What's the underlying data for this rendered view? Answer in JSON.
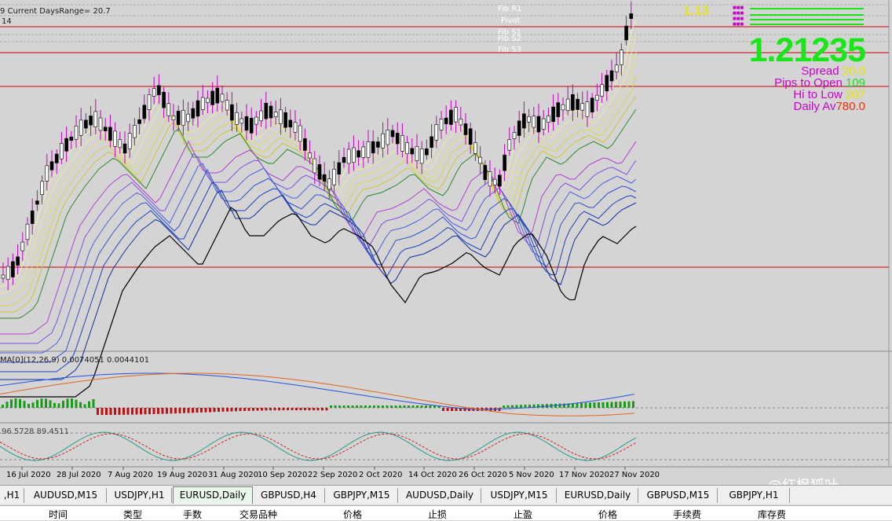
{
  "chart_info": {
    "line1": "9 Current DaysRange= 20.7",
    "line2": "14",
    "macd_label": "MA[0](12,26,9) 0.0074051 0.0044101",
    "stoch_label": "96.5728 89.4511"
  },
  "levels": {
    "fib_r1": "Fib R1",
    "pivot": "Pivot",
    "fib_s1": "Fib S1",
    "fib_s2": "Fib S2",
    "fib_s3": "Fib S3",
    "top_marker": "1.13"
  },
  "price_panel": {
    "price": "1.21235",
    "spread_label": "Spread",
    "spread_value": "20.0",
    "pips_open_label": "Pips to Open",
    "pips_open_value": "109",
    "hi_low_label": "Hi to Low",
    "hi_low_value": "207",
    "daily_av_label": "Daily Av",
    "daily_av_value": "780.0"
  },
  "date_axis": [
    "16 Jul 2020",
    "28 Jul 2020",
    "7 Aug 2020",
    "19 Aug 2020",
    "31 Aug 2020",
    "10 Sep 2020",
    "22 Sep 2020",
    "2 Oct 2020",
    "14 Oct 2020",
    "26 Oct 2020",
    "5 Nov 2020",
    "17 Nov 2020",
    "27 Nov 2020"
  ],
  "tabs": [
    {
      "label": ",H1",
      "active": false
    },
    {
      "label": "AUDUSD,M15",
      "active": false
    },
    {
      "label": "USDJPY,H1",
      "active": false
    },
    {
      "label": "EURUSD,Daily",
      "active": true
    },
    {
      "label": "GBPUSD,H4",
      "active": false
    },
    {
      "label": "GBPJPY,M15",
      "active": false
    },
    {
      "label": "AUDUSD,Daily",
      "active": false
    },
    {
      "label": "USDJPY,M15",
      "active": false
    },
    {
      "label": "EURUSD,Daily",
      "active": false
    },
    {
      "label": "GBPUSD,M15",
      "active": false
    },
    {
      "label": "GBPJPY,H1",
      "active": false
    }
  ],
  "table_header": [
    "时间",
    "类型",
    "手数",
    "交易品种",
    "价格",
    "止损",
    "止盈",
    "价格",
    "手续费",
    "库存费"
  ],
  "watermark": "@红枫狐叶",
  "colors": {
    "background": "#d4d4d4",
    "bull_candle": "#ffffff",
    "bear_candle": "#000000",
    "wick": "#c000c0",
    "level_line": "#cc0000",
    "price_green": "#19e619",
    "spread": "#cc00cc",
    "hist_up": "#1a9a1a",
    "hist_down": "#bb1111"
  }
}
